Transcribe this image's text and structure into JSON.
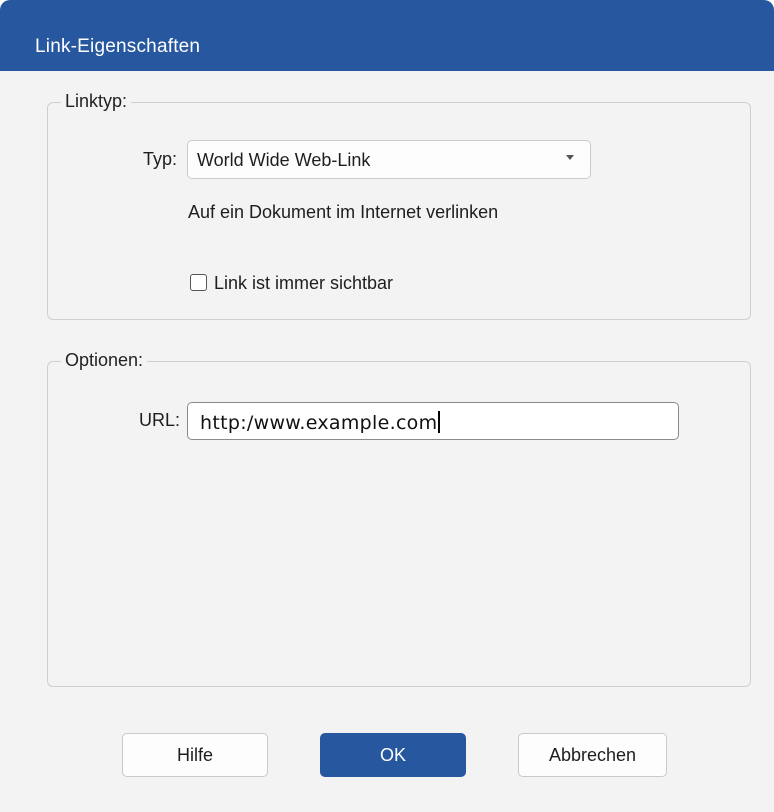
{
  "dialog": {
    "title": "Link-Eigenschaften"
  },
  "linktype_group": {
    "legend": "Linktyp:",
    "type_label": "Typ:",
    "type_value": "World Wide Web-Link",
    "description": "Auf ein Dokument im Internet verlinken",
    "always_visible_label": "Link ist immer sichtbar",
    "always_visible_checked": false
  },
  "options_group": {
    "legend": "Optionen:",
    "url_label": "URL:",
    "url_value": "http:/www.example.com"
  },
  "buttons": {
    "help": "Hilfe",
    "ok": "OK",
    "cancel": "Abbrechen"
  },
  "colors": {
    "accent": "#27579f",
    "dialog_background": "#f3f3f3"
  },
  "icons": {
    "dropdown": "chevron-down-icon",
    "checkbox": "checkbox-unchecked-icon"
  }
}
